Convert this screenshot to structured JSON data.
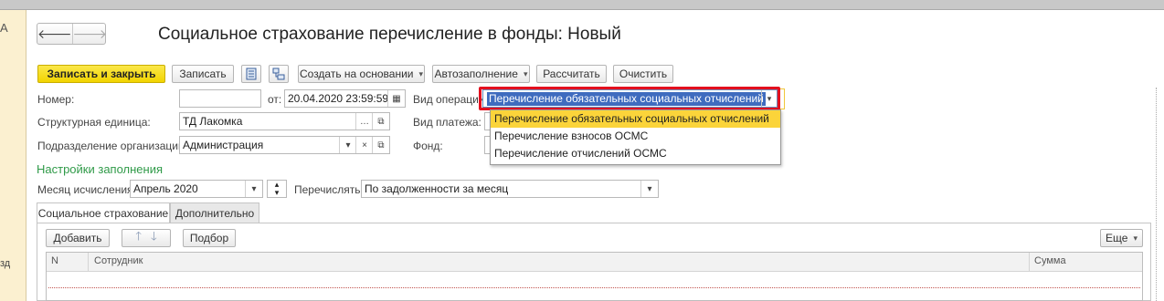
{
  "window": {
    "left_panel_top_text": "А",
    "left_panel_bottom_text": "зд"
  },
  "nav": {
    "back_icon": "arrow-left-icon",
    "forward_icon": "arrow-right-icon"
  },
  "title": "Социальное страхование перечисление в фонды: Новый",
  "toolbar": {
    "save_close": "Записать и закрыть",
    "save": "Записать",
    "create_based": "Создать на основании",
    "autofill": "Автозаполнение",
    "calculate": "Рассчитать",
    "clear": "Очистить"
  },
  "form": {
    "number_label": "Номер:",
    "number_value": "",
    "from_label": "от:",
    "date_value": "20.04.2020 23:59:59",
    "unit_label": "Структурная единица:",
    "unit_value": "ТД Лакомка",
    "division_label": "Подразделение организации:",
    "division_value": "Администрация",
    "operation_label": "Вид операции:",
    "operation_value": "Перечисление обязательных социальных отчислений",
    "payment_label": "Вид платежа:",
    "fund_label": "Фонд:"
  },
  "dropdown": {
    "options": [
      "Перечисление обязательных социальных отчислений",
      "Перечисление взносов ОСМС",
      "Перечисление отчислений ОСМС"
    ],
    "highlight_color": "#fbd43a"
  },
  "settings": {
    "heading": "Настройки заполнения",
    "month_label": "Месяц исчисления:",
    "month_value": "Апрель 2020",
    "transfer_label": "Перечислять:",
    "transfer_value": "По задолженности за месяц"
  },
  "tabs": [
    {
      "label": "Социальное страхование"
    },
    {
      "label": "Дополнительно"
    }
  ],
  "table_toolbar": {
    "add": "Добавить",
    "selection": "Подбор",
    "more": "Еще"
  },
  "table": {
    "columns": [
      "N",
      "Сотрудник",
      "Сумма"
    ]
  },
  "colors": {
    "accent_yellow": "#f2d400",
    "section_green": "#2f9a48",
    "selection_red": "#e3101e"
  }
}
